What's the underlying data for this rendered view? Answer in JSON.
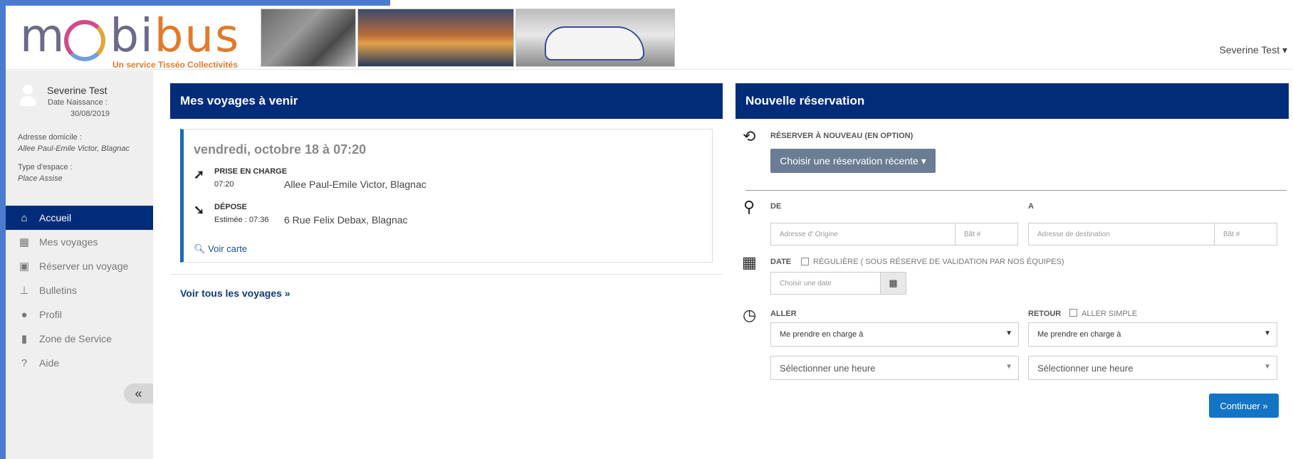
{
  "header": {
    "logo": {
      "part1": "m",
      "part2": "bi",
      "part3": "bus",
      "tagline": "Un service Tisséo Collectivités"
    },
    "user_label": "Severine Test ▾"
  },
  "sidebar": {
    "profile": {
      "name": "Severine Test",
      "dob_label": "Date Naissance :",
      "dob_value": "30/08/2019",
      "address_label": "Adresse domicile :",
      "address_value": "Allee Paul-Emile Victor, Blagnac",
      "space_label": "Type d'espace :",
      "space_value": "Place Assise"
    },
    "nav": [
      {
        "label": "Accueil",
        "icon": "home-icon",
        "glyph": "⌂"
      },
      {
        "label": "Mes voyages",
        "icon": "calendar-icon",
        "glyph": "▦"
      },
      {
        "label": "Réserver un voyage",
        "icon": "bus-icon",
        "glyph": "▣"
      },
      {
        "label": "Bulletins",
        "icon": "pin-icon",
        "glyph": "⊥"
      },
      {
        "label": "Profil",
        "icon": "user-icon",
        "glyph": "●"
      },
      {
        "label": "Zone de Service",
        "icon": "map-icon",
        "glyph": "▮"
      },
      {
        "label": "Aide",
        "icon": "help-icon",
        "glyph": "?"
      }
    ],
    "collapse_label": "«"
  },
  "trips": {
    "title": "Mes voyages à venir",
    "card": {
      "date": "vendredi, octobre 18 à 07:20",
      "pickup": {
        "title": "PRISE EN CHARGE",
        "time": "07:20",
        "address": "Allee Paul-Emile Victor, Blagnac",
        "icon": "arrow-up-right-icon",
        "glyph": "➚"
      },
      "dropoff": {
        "title": "DÉPOSE",
        "time": "Estimée : 07:36",
        "address": "6 Rue Felix Debax, Blagnac",
        "icon": "arrow-down-right-icon",
        "glyph": "➘"
      },
      "map_link": "Voir carte"
    },
    "all_link": "Voir tous les voyages »"
  },
  "reservation": {
    "title": "Nouvelle réservation",
    "rebook_label": "RÉSERVER À NOUVEAU (EN OPTION)",
    "recent_button": "Choisir une réservation récente ▾",
    "from_label": "DE",
    "to_label": "A",
    "origin_placeholder": "Adresse d' Origine",
    "origin_bat_placeholder": "Bât #",
    "dest_placeholder": "Adresse de destination",
    "dest_bat_placeholder": "Bât #",
    "date_label": "DATE",
    "regular_label": "RÉGULIÈRE ( SOUS RÉSERVE DE VALIDATION PAR NOS ÉQUIPES)",
    "date_placeholder": "Choisir une date",
    "aller_label": "ALLER",
    "retour_label": "RETOUR",
    "simple_label": "ALLER SIMPLE",
    "aller_mode": "Me prendre en charge à",
    "retour_mode": "Me prendre en charge à",
    "aller_time": "Sélectionner une heure",
    "retour_time": "Sélectionner une heure",
    "continue_button": "Continuer »"
  }
}
